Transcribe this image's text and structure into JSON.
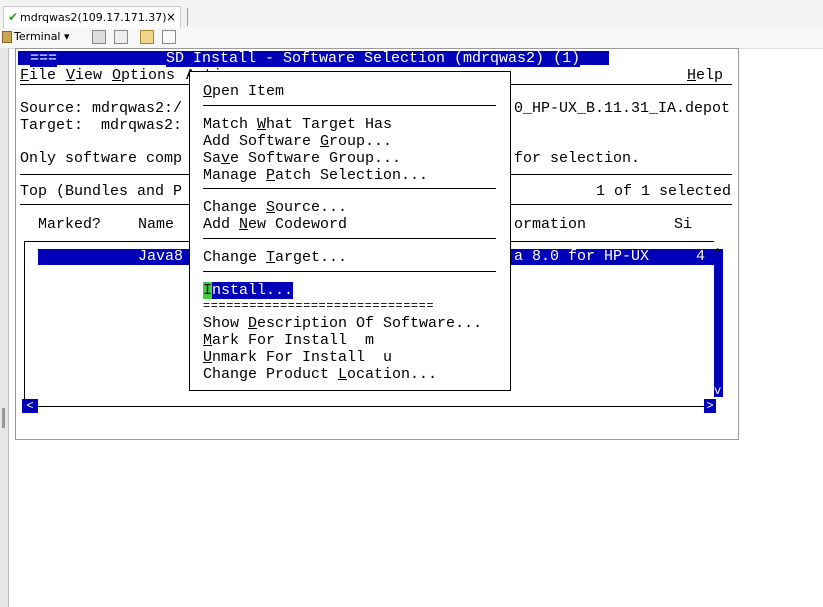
{
  "tab": {
    "title": "mdrqwas2(109.17.171.37)",
    "close": "×",
    "status_icon": "check-icon"
  },
  "toolbar": {
    "terminal_label": "Terminal",
    "dropdown_arrow": "▾"
  },
  "terminal": {
    "title_left": "===",
    "title": "SD Install - Software Selection (mdrqwas2) (1)",
    "menu": {
      "file": "File",
      "view": "View",
      "options": "Options",
      "actions": "Actions",
      "help": "Help"
    },
    "source_label": "Source: mdrqwas2:/",
    "source_tail": "0_HP-UX_B.11.31_IA.depot",
    "target_label": "Target:  mdrqwas2:",
    "only_software": "Only software comp",
    "only_software_tail": "for selection.",
    "top_bundles": "Top (Bundles and P",
    "selection_count": "1 of 1 selected",
    "col_marked": "Marked?",
    "col_name": "Name",
    "col_information": "ormation",
    "col_size": "Si",
    "row_name": "Java8",
    "row_info": "a 8.0 for HP-UX",
    "row_size": "4",
    "scroll_up": "^",
    "scroll_down": "v",
    "scroll_left": "<",
    "scroll_right": ">"
  },
  "actions_menu": {
    "open_item": "Open Item",
    "match_target": "Match What Target Has",
    "add_group": "Add Software Group...",
    "save_group": "Save Software Group...",
    "manage_patch": "Manage Patch Selection...",
    "change_source": "Change Source...",
    "add_codeword": "Add New Codeword",
    "change_target": "Change Target...",
    "install_first": "I",
    "install_rest": "nstall...",
    "equals_sep": "==============================",
    "show_description": "Show Description Of Software...",
    "mark_install": "Mark For Install  m",
    "unmark_install": "Unmark For Install  u",
    "change_location": "Change Product Location..."
  }
}
